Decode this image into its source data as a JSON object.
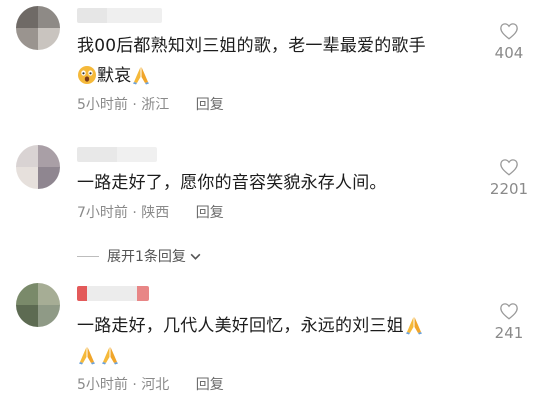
{
  "comments": [
    {
      "text": "我00后都熟知刘三姐的歌，老一辈最爱的歌手",
      "text_line2": "默哀",
      "time": "5小时前",
      "location": "浙江",
      "reply_label": "回复",
      "likes": "404"
    },
    {
      "text": "一路走好了，愿你的音容笑貌永存人间。",
      "time": "7小时前",
      "location": "陕西",
      "reply_label": "回复",
      "likes": "2201"
    },
    {
      "text": "一路走好，几代人美好回忆，永远的刘三姐",
      "time": "5小时前",
      "location": "河北",
      "reply_label": "回复",
      "likes": "241"
    }
  ],
  "expand_replies": "展开1条回复",
  "meta_separator": "·",
  "icons": {
    "like": "heart-outline-icon",
    "emoji_shocked": "shocked-face-emoji",
    "emoji_pray": "folded-hands-emoji",
    "expand": "chevron-down-icon"
  },
  "colors": {
    "text": "#1c1c1c",
    "meta": "#8a8a8a",
    "emoji_yellow": "#f5b93a"
  }
}
